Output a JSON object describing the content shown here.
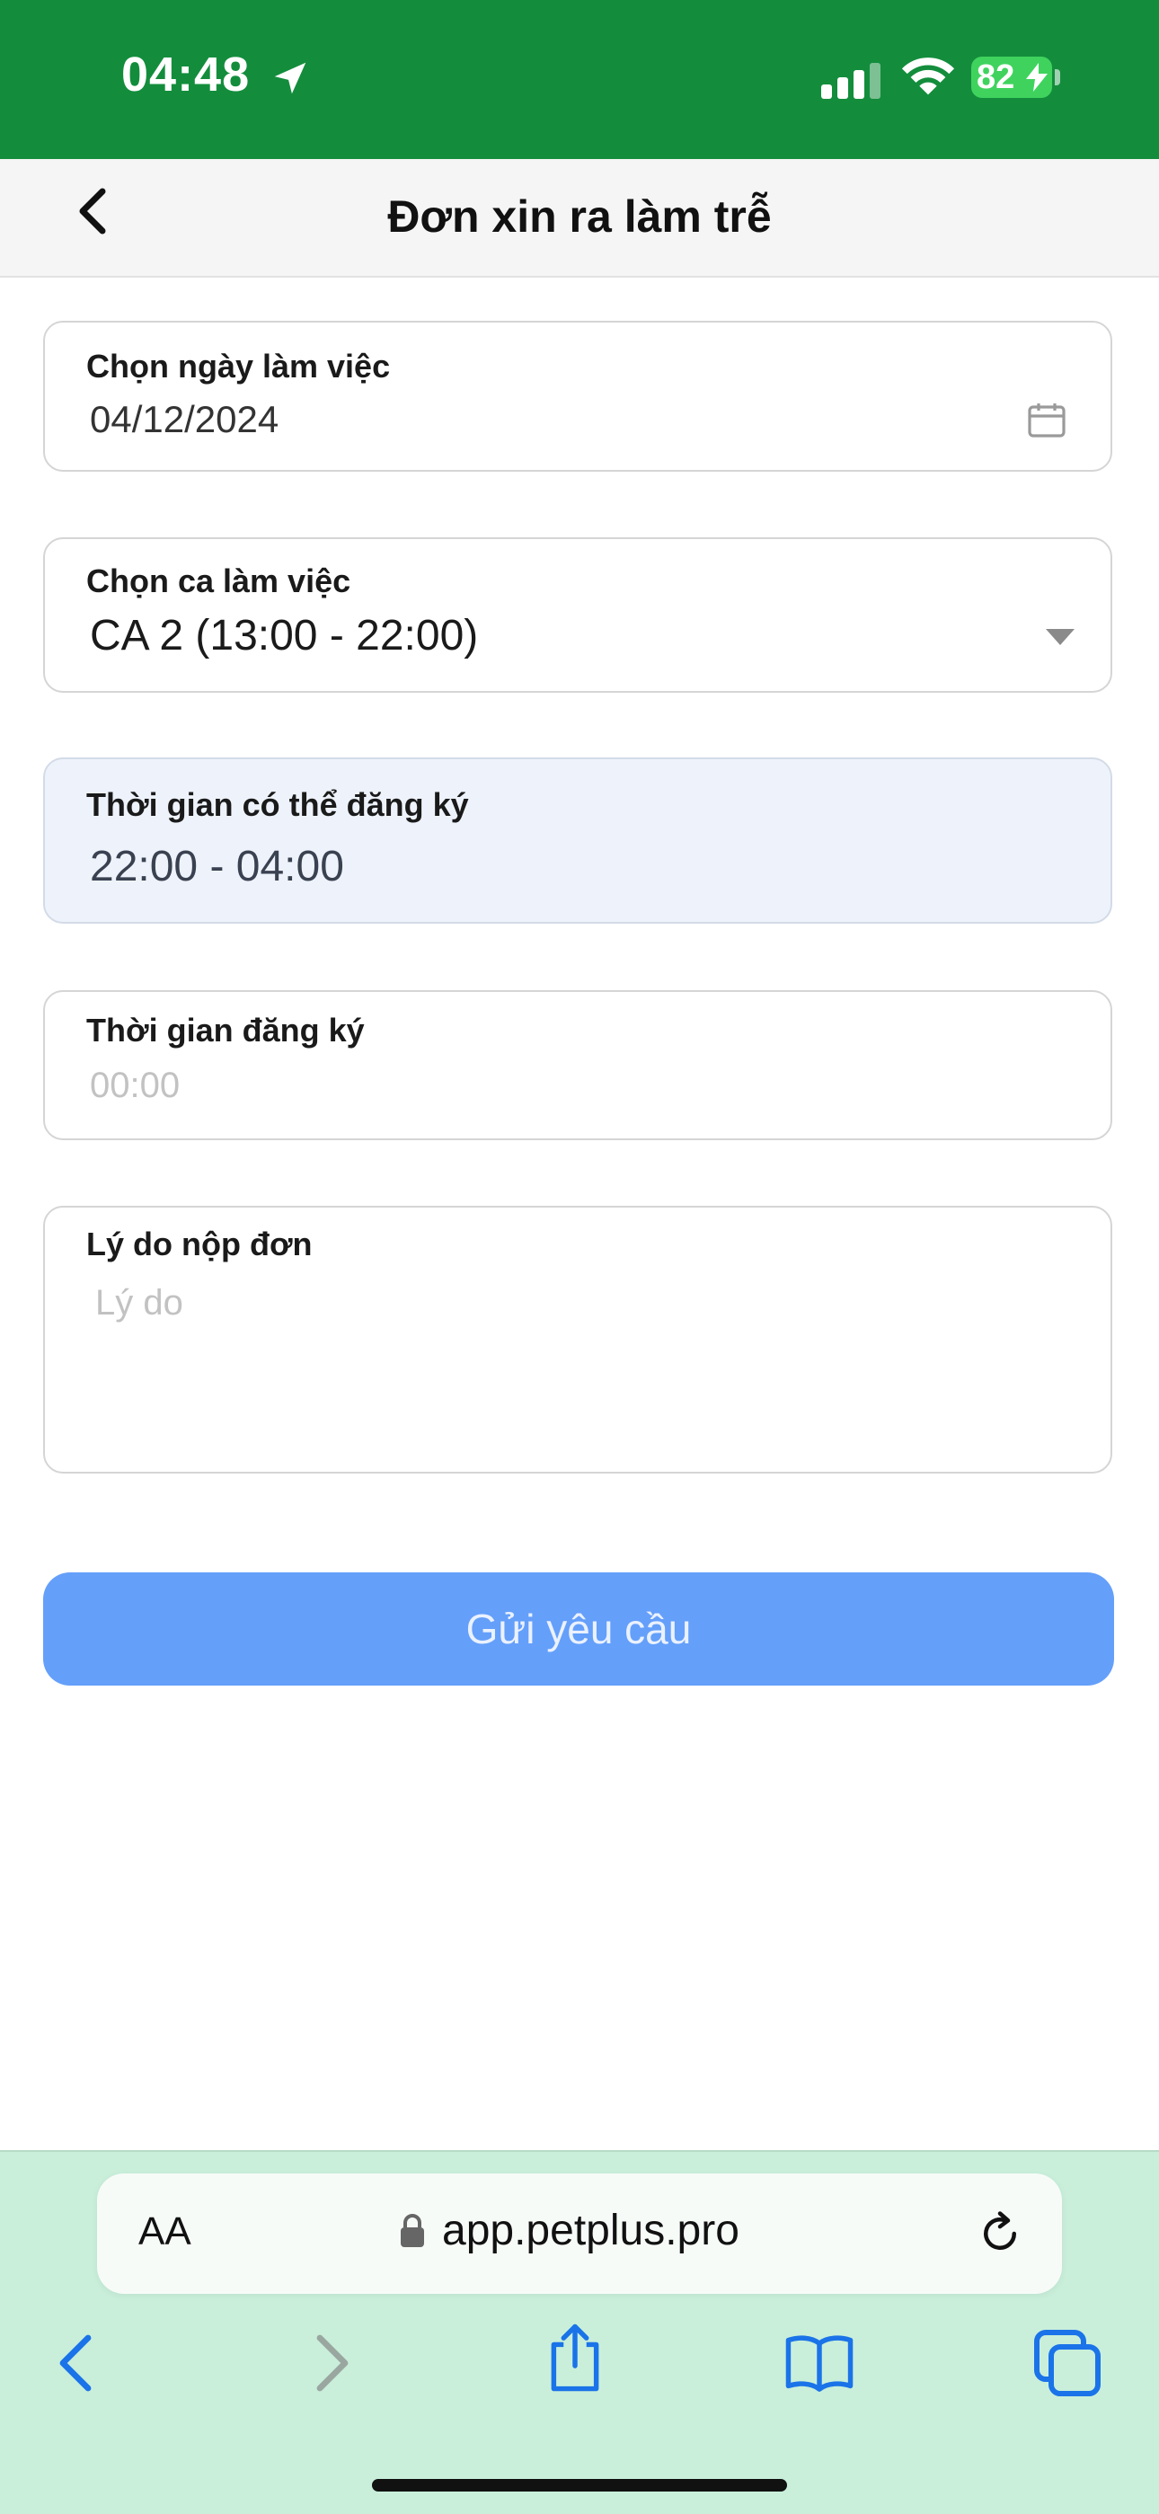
{
  "status_bar": {
    "time": "04:48",
    "battery": "82"
  },
  "header": {
    "title": "Đơn xin ra làm trễ"
  },
  "form": {
    "work_date": {
      "label": "Chọn ngày làm việc",
      "value": "04/12/2024"
    },
    "shift": {
      "label": "Chọn ca làm việc",
      "value": "CA 2 (13:00 - 22:00)"
    },
    "available_time": {
      "label": "Thời gian có thể đăng ký",
      "value": "22:00 - 04:00"
    },
    "register_time": {
      "label": "Thời gian đăng ký",
      "placeholder": "00:00"
    },
    "reason": {
      "label": "Lý do nộp đơn",
      "placeholder": "Lý do"
    },
    "submit_label": "Gửi yêu cầu"
  },
  "browser": {
    "text_size_label": "AA",
    "url": "app.petplus.pro"
  },
  "colors": {
    "status_bar": "#138d3c",
    "submit_button": "#649ffa",
    "browser_chrome": "#c9efdb",
    "readonly_field": "#eef3fb",
    "ios_link_blue": "#1a73e8"
  }
}
